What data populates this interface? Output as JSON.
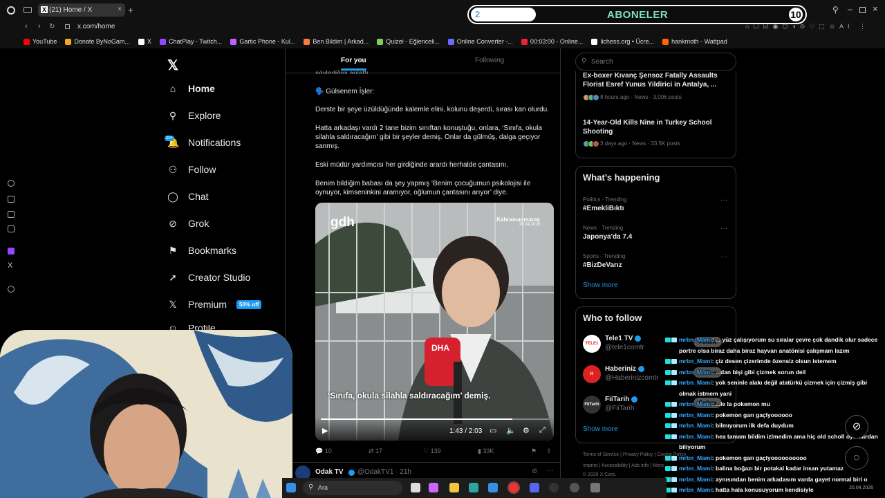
{
  "browser": {
    "tab_title": "(21) Home / X",
    "url": "x.com/home",
    "bookmarks": [
      {
        "label": "YouTube",
        "color": "#ff0000"
      },
      {
        "label": "Donate ByNoGam...",
        "color": "#f5a623"
      },
      {
        "label": "X",
        "color": "#ffffff"
      },
      {
        "label": "ChatPlay - Twitch...",
        "color": "#9146ff"
      },
      {
        "label": "Gartic Phone - Kul...",
        "color": "#c060ff"
      },
      {
        "label": "Ben Bildim | Arkad...",
        "color": "#ff7a3c"
      },
      {
        "label": "Quizei - Eğlenceli...",
        "color": "#7ccf5a"
      },
      {
        "label": "Online Converter -...",
        "color": "#6a6aff"
      },
      {
        "label": "00:03:00 - Online...",
        "color": "#e23"
      },
      {
        "label": "lichess.org • Ücre...",
        "color": "#ffffff"
      },
      {
        "label": "hankmoth - Wattpad",
        "color": "#ff6a00"
      }
    ]
  },
  "overlay": {
    "progress_value": "2",
    "progress_title": "ABONELER",
    "progress_goal": "10",
    "progress_fraction": 0.2
  },
  "x_nav": {
    "notif_badge": "20+",
    "items": [
      {
        "label": "Home",
        "icon": "home-icon",
        "glyph": "⌂"
      },
      {
        "label": "Explore",
        "icon": "search-icon",
        "glyph": "⚲"
      },
      {
        "label": "Notifications",
        "icon": "bell-icon",
        "glyph": "🔔"
      },
      {
        "label": "Follow",
        "icon": "add-person-icon",
        "glyph": "⚇"
      },
      {
        "label": "Chat",
        "icon": "chat-icon",
        "glyph": "◯"
      },
      {
        "label": "Grok",
        "icon": "grok-icon",
        "glyph": "⊘"
      },
      {
        "label": "Bookmarks",
        "icon": "bookmark-icon",
        "glyph": "⚑"
      },
      {
        "label": "Creator Studio",
        "icon": "rocket-icon",
        "glyph": "➚"
      },
      {
        "label": "Premium",
        "icon": "x-icon",
        "glyph": "𝕏"
      },
      {
        "label": "Profile",
        "icon": "profile-icon",
        "glyph": "☺"
      }
    ],
    "premium_badge": "50% off"
  },
  "feed": {
    "tab_for_you": "For you",
    "tab_following": "Following",
    "cut_line": "söylediğini anlattı.",
    "speaker": "🗣️ Gülsenem İşler:",
    "p1": "Derste bir şeye üzüldüğünde kalemle elini, kolunu deşerdi, sırası kan olurdu.",
    "p2": "Hatta arkadaşı vardı 2 tane bizim sınıftan konuştuğu, onlara, ‘Sınıfa, okula silahla saldıracağım’ gibi bir şeyler demiş. Onlar da gülmüş, dalga geçiyor sanmış.",
    "p3": "Eski müdür yardımcısı her girdiğinde arardı herhalde çantasını.",
    "p4": "Benim bildiğim babası da şey yapmış ‘Benim çocuğumun psikolojisi ile oynuyor, kimseninkini aramıyor, oğlumun çantasını arıyor’ diye.",
    "video": {
      "logo": "gdh",
      "location": "Kahramanmaraş",
      "date": "20.04.2026",
      "subtitle": "‘Sınıfa, okula silahla saldıracağım’ demiş.",
      "mic": "DHA",
      "time": "1:43 / 2:03",
      "progress": 0.84
    },
    "stats": {
      "replies": "10",
      "reposts": "17",
      "likes": "139",
      "views": "33K"
    },
    "next_author": "Odak TV",
    "next_handle": "@OdakTV1 · 21h"
  },
  "right": {
    "search_placeholder": "Search",
    "news1_title": "Ex-boxer Kıvanç Şensoz Fatally Assaults Florist Esref Yunus Yildirici in Antalya, ...",
    "news1_meta": "8 hours ago · News · 3,006 posts",
    "news2_title": "14-Year-Old Kills Nine in Turkey School Shooting",
    "news2_meta": "3 days ago · News · 33.5K posts",
    "happening_title": "What’s happening",
    "trends": [
      {
        "cat": "Politics · Trending",
        "name": "#EmekliBıktı"
      },
      {
        "cat": "News · Trending",
        "name": "Japonya'da 7.4"
      },
      {
        "cat": "Sports · Trending",
        "name": "#BizDeVarız"
      }
    ],
    "show_more": "Show more",
    "who_title": "Who to follow",
    "follow": [
      {
        "name": "Tele1 TV",
        "handle": "@tele1comtr",
        "avatar": "TELE1"
      },
      {
        "name": "Haberiniz",
        "handle": "@Haberinizcomtr",
        "avatar": "H"
      },
      {
        "name": "FiiTarih",
        "handle": "@FiiTarih",
        "avatar": "FiiTarih"
      }
    ],
    "follow_label": "Follow",
    "show_more2": "Show more",
    "footer1": "Terms of Service  |  Privacy Policy  |  Cookie Policy",
    "footer2": "Imprint  |  Accessibility  |  Ads info  |  More ...",
    "footer3": "© 2026 X Corp."
  },
  "chat": [
    {
      "user": "mrbn_Mami",
      "text": ": ... yüz çalışıyorum su sıralar çevre çok dandik olur sadece portre olsa biraz daha biraz hayvan anatönisi çalışmam lazım"
    },
    {
      "user": "mrbn_Mami",
      "text": ": çiz desen çizerimde özensiz olsun istemem"
    },
    {
      "user": "mrbn_Mami",
      "text": ": ...dan bişi gibi çizmek sorun deil"
    },
    {
      "user": "mrbn_Mami",
      "text": ": yok seninle alakı değil atatürkü çizmek için çizmiş gibi olmak istmem yani"
    },
    {
      "user": "mrbn_Mami",
      "text": ": ...le la pokemon mu"
    },
    {
      "user": "mrbn_Mami",
      "text": ": pokemon garı gaçlyoooooo"
    },
    {
      "user": "mrbn_Mami",
      "text": ": bilmıyorum ilk defa duydum"
    },
    {
      "user": "mrbn_Mami",
      "text": ": hea tamam bildim izlmedim ama hiç old scholl oyunlardan biliyorum"
    },
    {
      "user": "mrbn_Mami",
      "text": ": pokemon garı gaçlyoooooooooo"
    },
    {
      "user": "mrbn_Mami",
      "text": ": balina boğazı bir potakal kadar insan yutamaz"
    },
    {
      "user": "mrbn_Mami",
      "text": ": aynısından benim arkadasım varda gayet normal biri o"
    },
    {
      "user": "mrbn_Mami",
      "text": ": hatta hala konusuyorum kendisiyle"
    }
  ],
  "taskbar": {
    "search": "Ara",
    "date": "20.04.2026"
  }
}
